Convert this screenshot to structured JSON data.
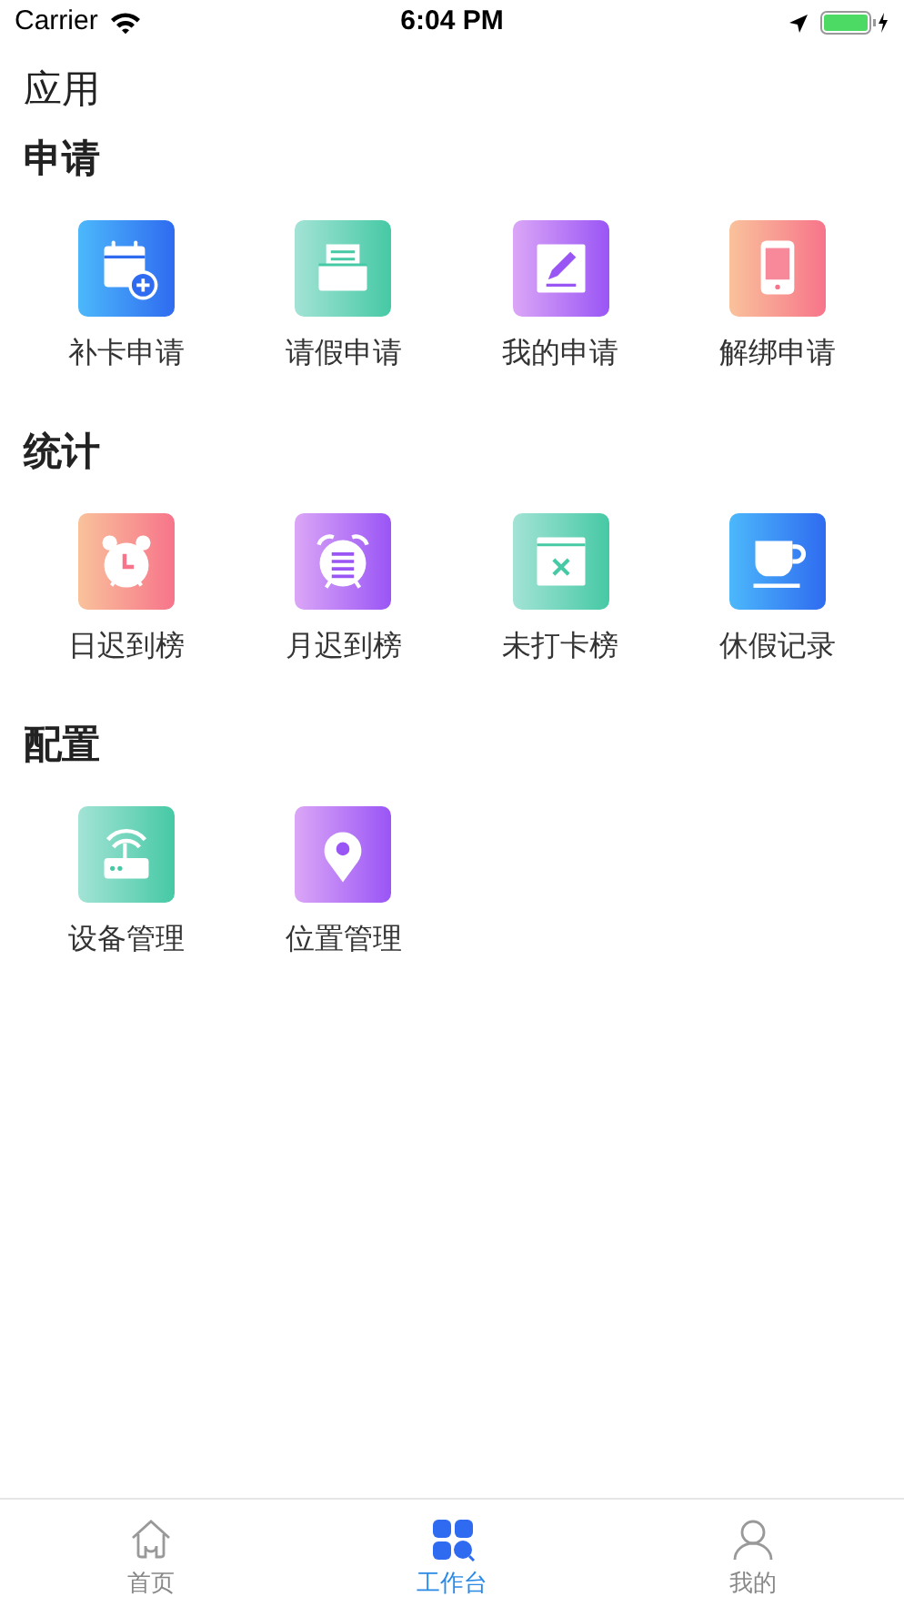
{
  "status_bar": {
    "carrier": "Carrier",
    "time": "6:04 PM"
  },
  "page_title": "应用",
  "sections": [
    {
      "title": "申请",
      "items": [
        {
          "label": "补卡申请",
          "kind": "calendar-add",
          "color": "#2f6bf0"
        },
        {
          "label": "请假申请",
          "kind": "tray",
          "color": "#46c9a5"
        },
        {
          "label": "我的申请",
          "kind": "pencil",
          "color": "#9a55f5"
        },
        {
          "label": "解绑申请",
          "kind": "phone",
          "color": "#f7748a"
        }
      ]
    },
    {
      "title": "统计",
      "items": [
        {
          "label": "日迟到榜",
          "kind": "clock",
          "color": "#f7748a"
        },
        {
          "label": "月迟到榜",
          "kind": "alarm-list",
          "color": "#9a55f5"
        },
        {
          "label": "未打卡榜",
          "kind": "calendar-x",
          "color": "#46c9a5"
        },
        {
          "label": "休假记录",
          "kind": "cup",
          "color": "#2f6bf0"
        }
      ]
    },
    {
      "title": "配置",
      "items": [
        {
          "label": "设备管理",
          "kind": "router",
          "color": "#46c9a5"
        },
        {
          "label": "位置管理",
          "kind": "pin",
          "color": "#9a55f5"
        }
      ]
    }
  ],
  "tabs": [
    {
      "label": "首页",
      "kind": "home",
      "selected": false
    },
    {
      "label": "工作台",
      "kind": "grid",
      "selected": true
    },
    {
      "label": "我的",
      "kind": "person",
      "selected": false
    }
  ]
}
